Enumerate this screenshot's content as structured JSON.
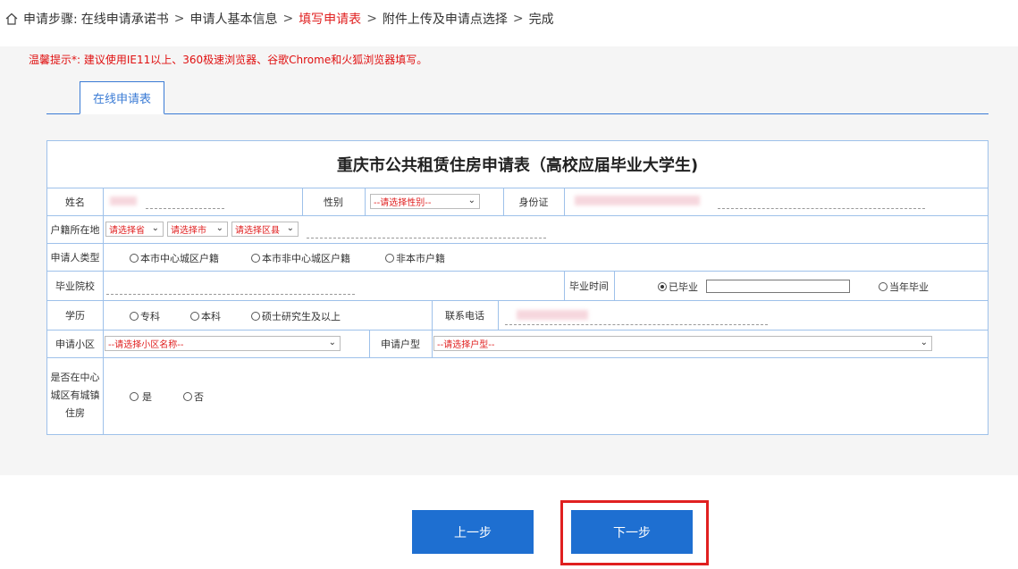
{
  "breadcrumb": {
    "prefix": "申请步骤:",
    "steps": [
      "在线申请承诺书",
      "申请人基本信息",
      "填写申请表",
      "附件上传及申请点选择",
      "完成"
    ],
    "separator": ">",
    "current_index": 2
  },
  "tip": "温馨提示*: 建议使用IE11以上、360极速浏览器、谷歌Chrome和火狐浏览器填写。",
  "tab": {
    "label": "在线申请表"
  },
  "form": {
    "title": "重庆市公共租赁住房申请表（高校应届毕业大学生)",
    "name_label": "姓名",
    "gender_label": "性别",
    "gender_select": "--请选择性别--",
    "id_label": "身份证",
    "hukou_label": "户籍所在地",
    "province_select": "请选择省",
    "city_select": "请选择市",
    "district_select": "请选择区县",
    "applicant_type_label": "申请人类型",
    "applicant_types": [
      "本市中心城区户籍",
      "本市非中心城区户籍",
      "非本市户籍"
    ],
    "school_label": "毕业院校",
    "grad_time_label": "毕业时间",
    "grad_graduated": "已毕业",
    "grad_current": "当年毕业",
    "education_label": "学历",
    "education_options": [
      "专科",
      "本科",
      "硕士研究生及以上"
    ],
    "phone_label": "联系电话",
    "community_label": "申请小区",
    "community_select": "--请选择小区名称--",
    "unit_type_label": "申请户型",
    "unit_type_select": "--请选择户型--",
    "housing_label_lines": [
      "是否在中心",
      "城区有城镇",
      "住房"
    ],
    "housing_yes": "是",
    "housing_no": "否"
  },
  "buttons": {
    "prev": "上一步",
    "next": "下一步"
  },
  "colors": {
    "accent": "#1e6fd1",
    "current_step": "#e02020",
    "tip": "#e01010",
    "border": "#9ec1ea"
  }
}
